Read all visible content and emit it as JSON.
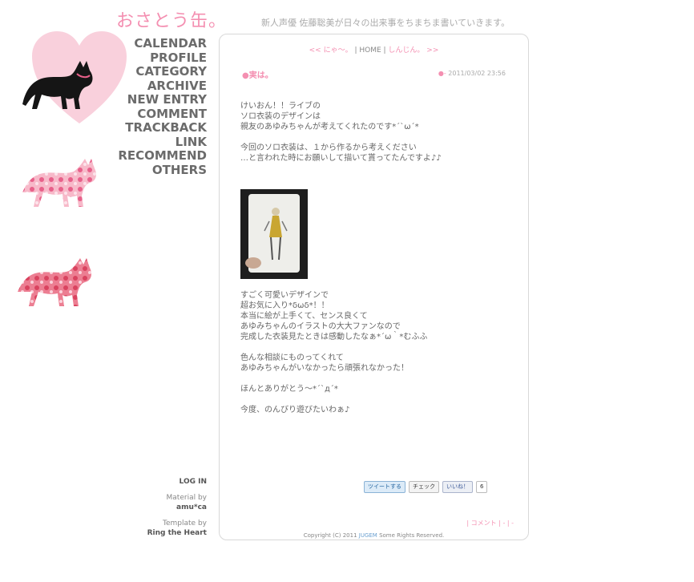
{
  "site": {
    "title": "おさとう缶。",
    "tagline": "新人声優 佐藤聡美が日々の出来事をちまちま書いていきます。"
  },
  "nav": {
    "items": [
      "CALENDAR",
      "PROFILE",
      "CATEGORY",
      "ARCHIVE",
      "NEW ENTRY",
      "COMMENT",
      "TRACKBACK",
      "LINK",
      "RECOMMEND",
      "OTHERS"
    ]
  },
  "sidebar_footer": {
    "login": "LOG IN",
    "material_label": "Material by",
    "material_name": "amu*ca",
    "template_label": "Template by",
    "template_name": "Ring the Heart"
  },
  "pager": {
    "prev": "<< にゃ～。",
    "sep1": " | ",
    "home": "HOME",
    "sep2": " | ",
    "next": "しんじん。 >>"
  },
  "entry": {
    "marker": "●",
    "title": "実は。",
    "date_marker": "●-",
    "date": "2011/03/02 23:56",
    "paragraph1": [
      "けいおん！！ライブの",
      "ソロ衣装のデザインは",
      "親友のあゆみちゃんが考えてくれたのです*´`ω´*",
      "",
      "今回のソロ衣装は、１から作るから考えください",
      "…と言われた時にお願いして描いて貰ってたんですよ♪♪"
    ],
    "paragraph2": [
      "すごく可愛いデザインで",
      "超お気に入り*δωδ*！！",
      "本当に絵が上手くて、センス良くて",
      "あゆみちゃんのイラストの大大ファンなので",
      "完成した衣装見たときは感動したなぁ*´ω｀*むふふ",
      "",
      "色んな相談にものってくれて",
      "あゆみちゃんがいなかったら頑張れなかった！",
      "",
      "ほんとありがとう～*´`д´*",
      "",
      "今度、のんびり遊びたいわぁ♪"
    ]
  },
  "social": {
    "tweet": "ツイートする",
    "check": "チェック",
    "like": "いいね！",
    "like_count": "6"
  },
  "comments_link": "| コメント | - | -",
  "copyright": {
    "prefix": "Copyright (C) 2011 ",
    "brand": "JUGEM",
    "suffix": " Some Rights Reserved."
  },
  "colors": {
    "accent_pink": "#f48fb1",
    "heart_pink": "#f9d0dc",
    "nav_gray": "#6b6b6b"
  }
}
